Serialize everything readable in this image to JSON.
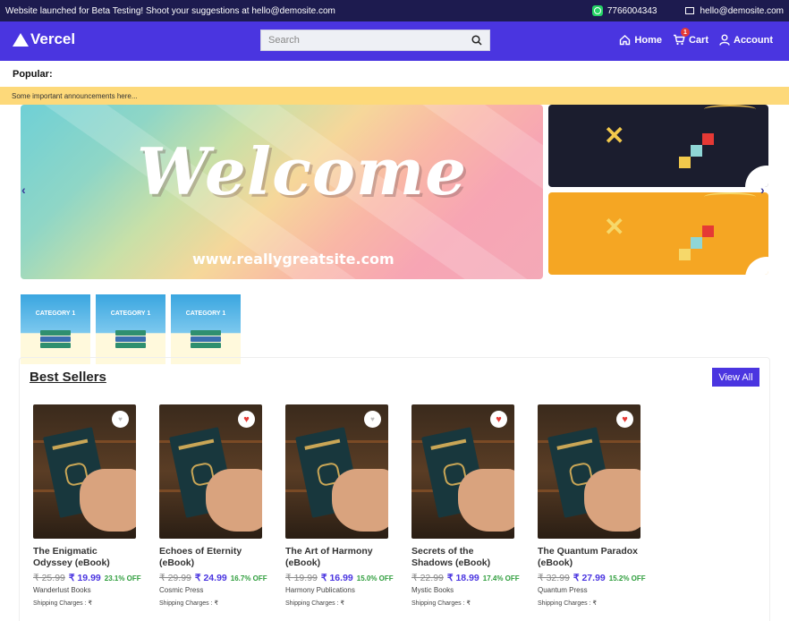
{
  "topbar": {
    "message": "Website launched for Beta Testing! Shoot your suggestions at hello@demosite.com",
    "phone": "7766004343",
    "email": "hello@demosite.com"
  },
  "header": {
    "logo": "Vercel",
    "search_placeholder": "Search",
    "nav": {
      "home": "Home",
      "cart": "Cart",
      "cart_count": "1",
      "account": "Account"
    }
  },
  "popular_label": "Popular:",
  "announcement": "Some important announcements here...",
  "banner": {
    "heading": "Welcome",
    "url": "www.reallygreatsite.com"
  },
  "categories": [
    {
      "label": "CATEGORY 1"
    },
    {
      "label": "CATEGORY 1"
    },
    {
      "label": "CATEGORY 1"
    }
  ],
  "best_sellers": {
    "title": "Best Sellers",
    "view_all": "View All",
    "products": [
      {
        "title": "The Enigmatic Odyssey (eBook)",
        "old_price": "₹ 25.99",
        "price": "₹ 19.99",
        "discount": "23.1% OFF",
        "publisher": "Wanderlust Books",
        "shipping": "Shipping Charges : ₹",
        "favorited": false
      },
      {
        "title": "Echoes of Eternity (eBook)",
        "old_price": "₹ 29.99",
        "price": "₹ 24.99",
        "discount": "16.7% OFF",
        "publisher": "Cosmic Press",
        "shipping": "Shipping Charges : ₹",
        "favorited": true
      },
      {
        "title": "The Art of Harmony (eBook)",
        "old_price": "₹ 19.99",
        "price": "₹ 16.99",
        "discount": "15.0% OFF",
        "publisher": "Harmony Publications",
        "shipping": "Shipping Charges : ₹",
        "favorited": false
      },
      {
        "title": "Secrets of the Shadows (eBook)",
        "old_price": "₹ 22.99",
        "price": "₹ 18.99",
        "discount": "17.4% OFF",
        "publisher": "Mystic Books",
        "shipping": "Shipping Charges : ₹",
        "favorited": true
      },
      {
        "title": "The Quantum Paradox (eBook)",
        "old_price": "₹ 32.99",
        "price": "₹ 27.99",
        "discount": "15.2% OFF",
        "publisher": "Quantum Press",
        "shipping": "Shipping Charges : ₹",
        "favorited": true
      }
    ]
  },
  "colors": {
    "brand": "#4a35e0",
    "topbar": "#1d1b4f",
    "announcement": "#fdd97a",
    "discount": "#2e9d3c",
    "heart_active": "#e53935"
  }
}
